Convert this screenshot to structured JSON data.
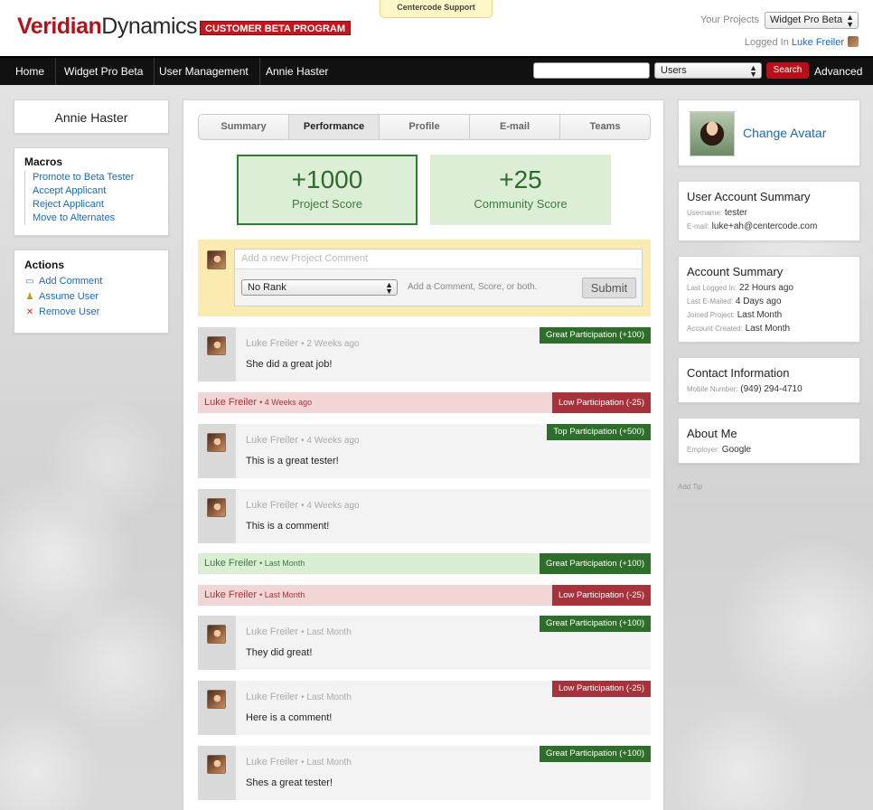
{
  "brand": {
    "first": "Veridian",
    "second": "Dynamics",
    "badge": "CUSTOMER BETA PROGRAM"
  },
  "support_tab": "Centercode Support",
  "header": {
    "your_projects_label": "Your Projects",
    "project_selected": "Widget Pro Beta",
    "logged_in_label": "Logged In",
    "logged_in_user": "Luke Freiler"
  },
  "nav": {
    "items": [
      "Home",
      "Widget Pro Beta",
      "User Management",
      "Annie Haster"
    ],
    "search_scope": "Users",
    "search_button": "Search",
    "advanced": "Advanced"
  },
  "left": {
    "user_name": "Annie Haster",
    "macros_title": "Macros",
    "macros": [
      "Promote to Beta Tester",
      "Accept Applicant",
      "Reject Applicant",
      "Move to Alternates"
    ],
    "actions_title": "Actions",
    "actions": [
      {
        "label": "Add Comment",
        "icon": "comment-icon"
      },
      {
        "label": "Assume User",
        "icon": "assume-user-icon"
      },
      {
        "label": "Remove User",
        "icon": "remove-x-icon"
      }
    ]
  },
  "tabs": [
    "Summary",
    "Performance",
    "Profile",
    "E-mail",
    "Teams"
  ],
  "active_tab": "Performance",
  "scores": {
    "project": {
      "value": "+1000",
      "label": "Project Score"
    },
    "community": {
      "value": "+25",
      "label": "Community Score"
    }
  },
  "composer": {
    "placeholder": "Add a new Project Comment",
    "rank_selected": "No Rank",
    "hint": "Add a Comment, Score, or both.",
    "submit": "Submit"
  },
  "feed": [
    {
      "kind": "comment",
      "author": "Luke Freiler",
      "time": "• 2 Weeks ago",
      "text": "She did a great job!",
      "badge": "Great Participation (+100)",
      "tone": "good"
    },
    {
      "kind": "strip",
      "author": "Luke Freiler",
      "time": "• 4 Weeks ago",
      "badge": "Low Participation (-25)",
      "tone": "bad"
    },
    {
      "kind": "comment",
      "author": "Luke Freiler",
      "time": "• 4 Weeks ago",
      "text": "This is a great tester!",
      "badge": "Top Participation (+500)",
      "tone": "good"
    },
    {
      "kind": "comment",
      "author": "Luke Freiler",
      "time": "• 4 Weeks ago",
      "text": "This is a comment!",
      "badge": "",
      "tone": ""
    },
    {
      "kind": "strip",
      "author": "Luke Freiler",
      "time": "• Last Month",
      "badge": "Great Participation (+100)",
      "tone": "good"
    },
    {
      "kind": "strip",
      "author": "Luke Freiler",
      "time": "• Last Month",
      "badge": "Low Participation (-25)",
      "tone": "bad"
    },
    {
      "kind": "comment",
      "author": "Luke Freiler",
      "time": "• Last Month",
      "text": "They did great!",
      "badge": "Great Participation (+100)",
      "tone": "good"
    },
    {
      "kind": "comment",
      "author": "Luke Freiler",
      "time": "• Last Month",
      "text": "Here is a comment!",
      "badge": "Low Participation (-25)",
      "tone": "bad"
    },
    {
      "kind": "comment",
      "author": "Luke Freiler",
      "time": "• Last Month",
      "text": "Shes a great tester!",
      "badge": "Great Participation (+100)",
      "tone": "good"
    }
  ],
  "right": {
    "change_avatar": "Change Avatar",
    "account_summary": {
      "title": "User Account Summary",
      "username_label": "Username:",
      "username": "tester",
      "email_label": "E-mail:",
      "email": "luke+ah@centercode.com"
    },
    "account": {
      "title": "Account Summary",
      "last_login_label": "Last Logged In:",
      "last_login": "22 Hours ago",
      "last_emailed_label": "Last E-Mailed:",
      "last_emailed": "4 Days ago",
      "joined_label": "Joined Project:",
      "joined": "Last Month",
      "created_label": "Account Created:",
      "created": "Last Month"
    },
    "contact": {
      "title": "Contact Information",
      "mobile_label": "Mobile Number:",
      "mobile": "(949) 294-4710"
    },
    "about": {
      "title": "About Me",
      "employer_label": "Employer:",
      "employer": "Google"
    },
    "add_tip": "Add Tip"
  },
  "colors": {
    "brand_red": "#b8101a",
    "good_green": "#2e6e2b",
    "bad_red": "#a6323b",
    "link_blue": "#1a6bb8"
  }
}
